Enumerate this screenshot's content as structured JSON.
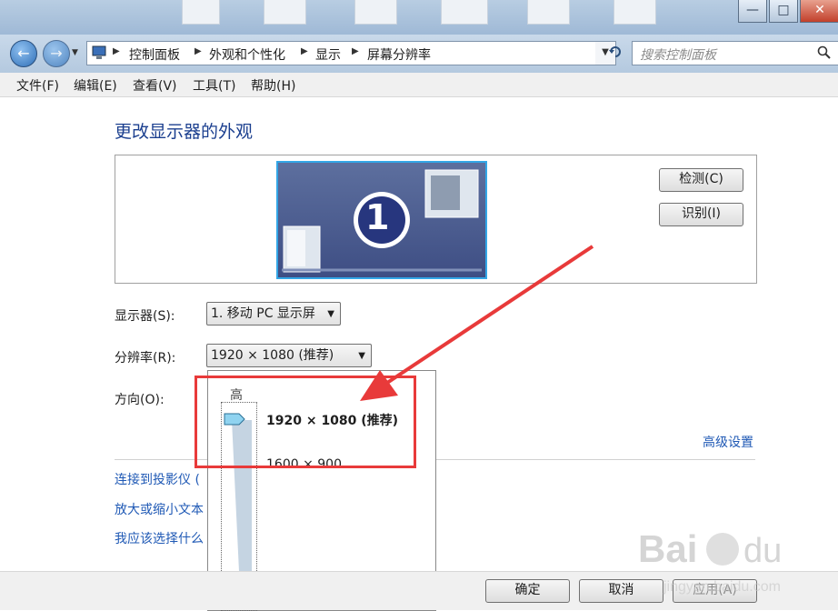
{
  "window": {
    "minimize": "—",
    "maximize": "□",
    "close": "✕"
  },
  "nav": {
    "breadcrumbs": [
      "控制面板",
      "外观和个性化",
      "显示",
      "屏幕分辨率"
    ],
    "search_placeholder": "搜索控制面板"
  },
  "menu": [
    "文件(F)",
    "编辑(E)",
    "查看(V)",
    "工具(T)",
    "帮助(H)"
  ],
  "page": {
    "heading": "更改显示器的外观",
    "monitor_number": "1",
    "detect_button": "检测(C)",
    "identify_button": "识别(I)",
    "display_label": "显示器(S):",
    "display_value": "1. 移动 PC 显示屏",
    "resolution_label": "分辨率(R):",
    "resolution_value": "1920 × 1080 (推荐)",
    "orientation_label": "方向(O):",
    "advanced_link": "高级设置",
    "links": [
      "连接到投影仪 (",
      "放大或缩小文本",
      "我应该选择什么"
    ]
  },
  "resolution_dropdown": {
    "high_label": "高",
    "options": [
      "1920 × 1080 (推荐)",
      "1600 × 900"
    ]
  },
  "buttons": {
    "ok": "确定",
    "cancel": "取消",
    "apply": "应用(A)"
  },
  "colors": {
    "accent_link": "#1f59b5",
    "heading": "#1b3f8f",
    "annotation_red": "#e83a3a",
    "monitor": "#3e4e84"
  },
  "icons": [
    "back-arrow-icon",
    "forward-arrow-icon",
    "control-panel-icon",
    "refresh-icon",
    "search-icon",
    "dropdown-arrow-icon",
    "annotation-arrow"
  ]
}
